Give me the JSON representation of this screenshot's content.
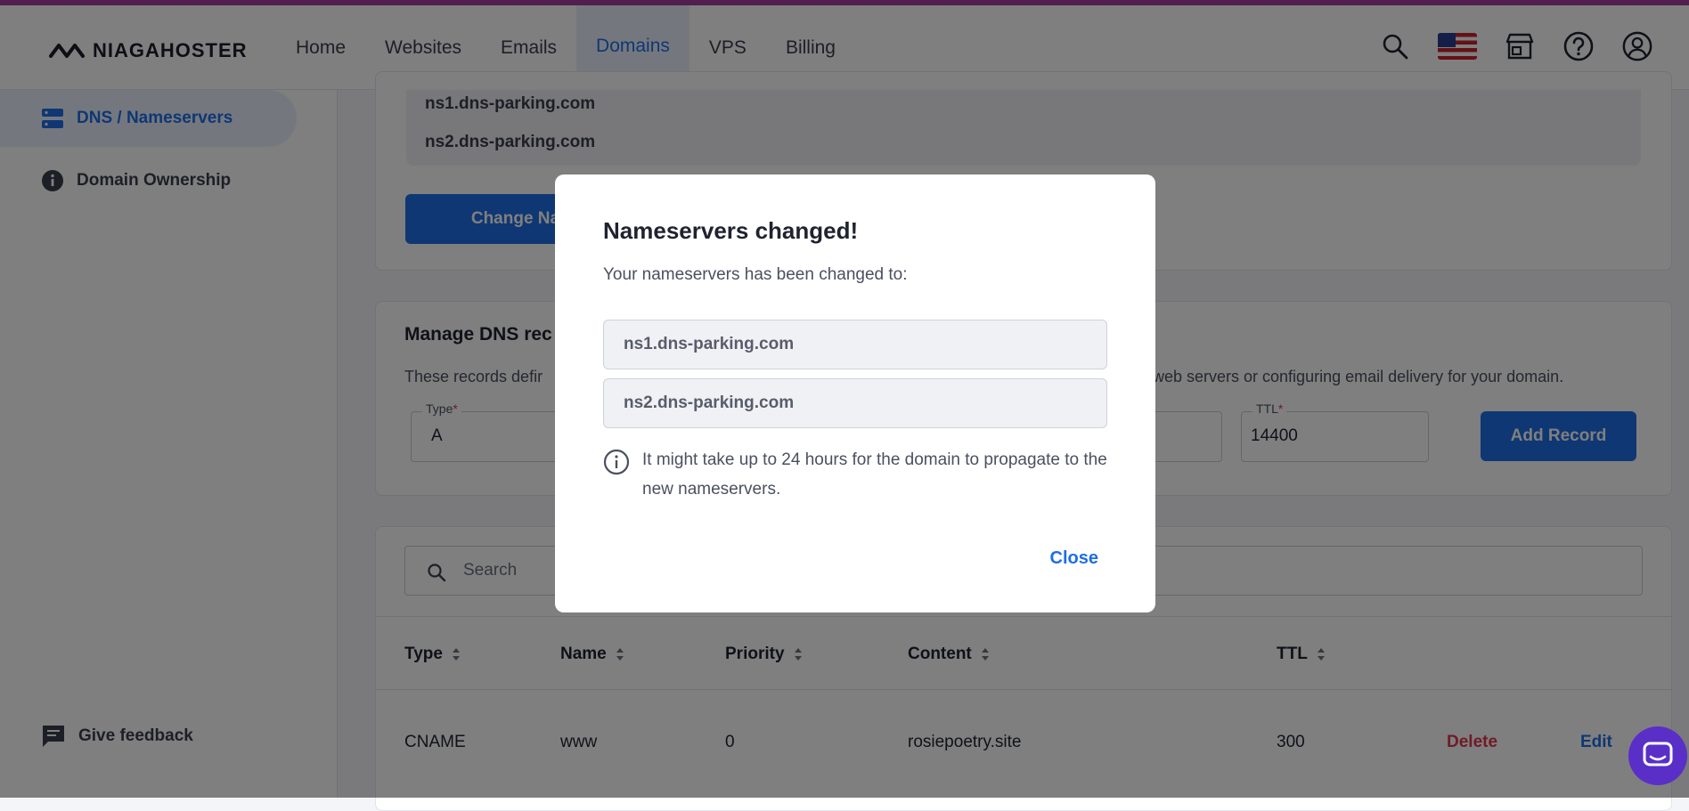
{
  "header": {
    "logo_text": "NIAGAHOSTER",
    "nav": [
      {
        "label": "Home"
      },
      {
        "label": "Websites"
      },
      {
        "label": "Emails"
      },
      {
        "label": "Domains"
      },
      {
        "label": "VPS"
      },
      {
        "label": "Billing"
      }
    ],
    "active_nav": "Domains",
    "icons": [
      "search-icon",
      "us-flag-icon",
      "store-icon",
      "help-icon",
      "account-icon"
    ]
  },
  "sidebar": {
    "items": [
      {
        "label": "DNS / Nameservers",
        "icon": "dns-icon",
        "active": true
      },
      {
        "label": "Domain Ownership",
        "icon": "info-icon",
        "active": false
      }
    ],
    "feedback_label": "Give feedback"
  },
  "nameservers_card": {
    "ns": [
      "ns1.dns-parking.com",
      "ns2.dns-parking.com"
    ],
    "change_button": "Change Names"
  },
  "dns_card": {
    "title": "Manage DNS rec",
    "desc_left": "These records defir",
    "desc_right": "web servers or configuring email delivery for your domain.",
    "type_label": "Type",
    "type_value": "A",
    "ttl_label": "TTL",
    "ttl_value": "14400",
    "add_button": "Add Record"
  },
  "records": {
    "search_placeholder": "Search",
    "columns": [
      "Type",
      "Name",
      "Priority",
      "Content",
      "TTL"
    ],
    "rows": [
      {
        "type": "CNAME",
        "name": "www",
        "priority": "0",
        "content": "rosiepoetry.site",
        "ttl": "300",
        "delete": "Delete",
        "edit": "Edit"
      }
    ]
  },
  "modal": {
    "title": "Nameservers changed!",
    "subtitle": "Your nameservers has been changed to:",
    "ns": [
      "ns1.dns-parking.com",
      "ns2.dns-parking.com"
    ],
    "note": "It might take up to 24 hours for the domain to propagate to the new nameservers.",
    "close_label": "Close"
  },
  "colors": {
    "accent": "#1f6ee6",
    "danger": "#e0374c",
    "chat": "#5a2fc7",
    "top_strip": "#a23d9c"
  }
}
